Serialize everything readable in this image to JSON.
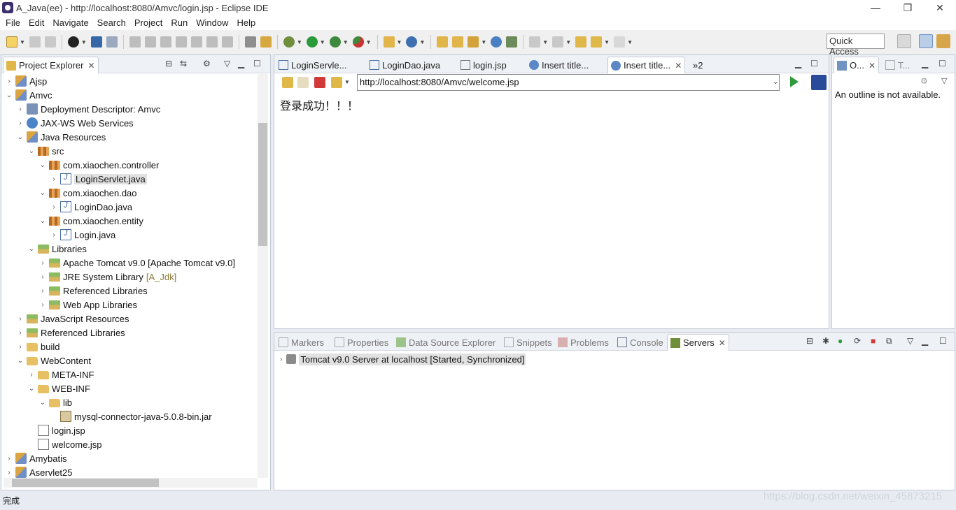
{
  "window": {
    "title": "A_Java(ee) - http://localhost:8080/Amvc/login.jsp - Eclipse IDE",
    "minimize": "—",
    "restore": "❐",
    "close": "✕"
  },
  "menu": [
    "File",
    "Edit",
    "Navigate",
    "Search",
    "Project",
    "Run",
    "Window",
    "Help"
  ],
  "toolbar": {
    "quick_access": "Quick Access"
  },
  "project_explorer": {
    "title": "Project Explorer",
    "close": "✕",
    "rows": [
      {
        "label": "Ajsp",
        "icon": "project-icon",
        "twisty": "›"
      },
      {
        "label": "Amvc",
        "icon": "project-icon",
        "twisty": "⌄"
      },
      {
        "label": "Deployment Descriptor: Amvc",
        "icon": "deployment-descriptor-icon",
        "twisty": "›"
      },
      {
        "label": "JAX-WS Web Services",
        "icon": "web-services-icon",
        "twisty": "›"
      },
      {
        "label": "Java Resources",
        "icon": "java-resources-icon",
        "twisty": "⌄"
      },
      {
        "label": "src",
        "icon": "source-folder-icon",
        "twisty": "⌄"
      },
      {
        "label": "com.xiaochen.controller",
        "icon": "package-icon",
        "twisty": "⌄"
      },
      {
        "label": "LoginServlet.java",
        "icon": "java-file-icon",
        "twisty": "›",
        "selected": true
      },
      {
        "label": "com.xiaochen.dao",
        "icon": "package-icon",
        "twisty": "⌄"
      },
      {
        "label": "LoginDao.java",
        "icon": "java-file-icon",
        "twisty": "›"
      },
      {
        "label": "com.xiaochen.entity",
        "icon": "package-icon",
        "twisty": "⌄"
      },
      {
        "label": "Login.java",
        "icon": "java-file-icon",
        "twisty": "›"
      },
      {
        "label": "Libraries",
        "icon": "libraries-icon",
        "twisty": "⌄"
      },
      {
        "label": "Apache Tomcat v9.0 [Apache Tomcat v9.0]",
        "icon": "library-icon",
        "twisty": "›"
      },
      {
        "label": "JRE System Library",
        "decor": "[A_Jdk]",
        "icon": "library-icon",
        "twisty": "›"
      },
      {
        "label": "Referenced Libraries",
        "icon": "library-icon",
        "twisty": "›"
      },
      {
        "label": "Web App Libraries",
        "icon": "library-icon",
        "twisty": "›"
      },
      {
        "label": "JavaScript Resources",
        "icon": "library-icon",
        "twisty": "›"
      },
      {
        "label": "Referenced Libraries",
        "icon": "library-icon",
        "twisty": "›"
      },
      {
        "label": "build",
        "icon": "folder-icon",
        "twisty": "›"
      },
      {
        "label": "WebContent",
        "icon": "folder-icon",
        "twisty": "⌄"
      },
      {
        "label": "META-INF",
        "icon": "folder-icon",
        "twisty": "›"
      },
      {
        "label": "WEB-INF",
        "icon": "folder-icon",
        "twisty": "⌄"
      },
      {
        "label": "lib",
        "icon": "folder-icon",
        "twisty": "⌄"
      },
      {
        "label": "mysql-connector-java-5.0.8-bin.jar",
        "icon": "jar-icon",
        "twisty": ""
      },
      {
        "label": "login.jsp",
        "icon": "jsp-file-icon",
        "twisty": ""
      },
      {
        "label": "welcome.jsp",
        "icon": "jsp-file-icon",
        "twisty": ""
      },
      {
        "label": "Amybatis",
        "icon": "project-icon",
        "twisty": "›"
      },
      {
        "label": "Aservlet25",
        "icon": "project-icon",
        "twisty": "›"
      }
    ]
  },
  "editor": {
    "tabs": [
      {
        "label": "LoginServle...",
        "icon": "java-file-icon"
      },
      {
        "label": "LoginDao.java",
        "icon": "java-file-icon"
      },
      {
        "label": "login.jsp",
        "icon": "jsp-file-icon"
      },
      {
        "label": "Insert title...",
        "icon": "globe-icon"
      },
      {
        "label": "Insert title...",
        "icon": "globe-icon",
        "active": true
      }
    ],
    "overflow": "»2",
    "browser": {
      "url": "http://localhost:8080/Amvc/welcome.jsp",
      "content": "登录成功！！！"
    }
  },
  "outline": {
    "tab_outline": "O...",
    "tab_tasks": "T...",
    "message": "An outline is not available."
  },
  "bottom": {
    "tabs": [
      "Markers",
      "Properties",
      "Data Source Explorer",
      "Snippets",
      "Problems",
      "Console",
      "Servers"
    ],
    "active_tab": "Servers",
    "server_row": "Tomcat v9.0 Server at localhost  [Started, Synchronized]"
  },
  "status": {
    "text": "完成",
    "watermark": "https://blog.csdn.net/weixin_45873215"
  },
  "colors": {
    "accent": "#2b5fa8",
    "panel_border": "#c4cad3",
    "selection": "#e1e1e1"
  }
}
